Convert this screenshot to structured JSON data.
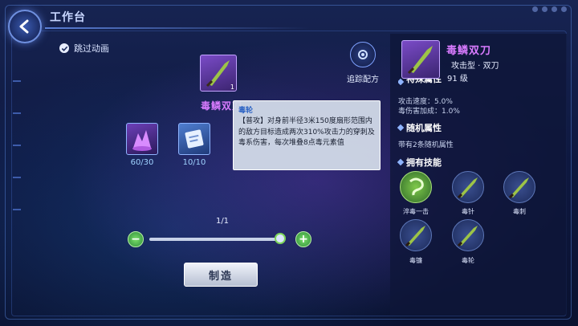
{
  "header": {
    "title": "工作台"
  },
  "options": {
    "skip_animation_label": "跳过动画"
  },
  "craft": {
    "item_name": "毒鳞双刀",
    "item_count": "1",
    "trace_recipe_label": "追踪配方",
    "materials": [
      {
        "count": "60/30",
        "icon": "purple-crystal-icon"
      },
      {
        "count": "10/10",
        "icon": "blueprint-icon"
      }
    ],
    "quantity": "1/1",
    "make_label": "制造"
  },
  "tooltip": {
    "name": "毒轮",
    "desc": "【普攻】对身前半径3米150度扇形范围内的敌方目标造成两次310%攻击力的穿刺及毒系伤害，每次堆叠8点毒元素值"
  },
  "detail": {
    "name": "毒鳞双刀",
    "type": "攻击型 · 双刀",
    "level": "91 级",
    "special_title": "特殊属性",
    "special_attrs": [
      "攻击速度：5.0%",
      "毒伤害加成：1.0%"
    ],
    "random_title": "随机属性",
    "random_desc": "带有2条随机属性",
    "skills_title": "拥有技能",
    "skills": [
      {
        "label": "淬毒一击",
        "icon": "poison-whirl-icon"
      },
      {
        "label": "毒针",
        "icon": "dagger-icon"
      },
      {
        "label": "毒刺",
        "icon": "dagger-icon"
      },
      {
        "label": "毒镰",
        "icon": "dagger-icon"
      },
      {
        "label": "毒轮",
        "icon": "dagger-icon"
      }
    ]
  },
  "colors": {
    "rare_purple": "#d97bff",
    "accent_blue": "#8fb4ff",
    "confirm_green": "#7be06a"
  }
}
